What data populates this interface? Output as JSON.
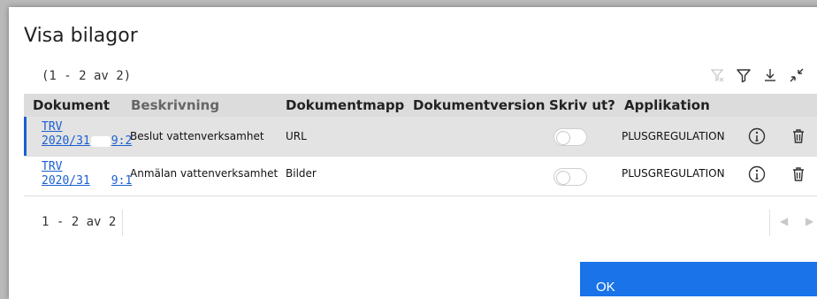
{
  "dialog": {
    "title": "Visa bilagor",
    "count_label": "(1 - 2 av 2)",
    "ok_label": "OK"
  },
  "toolbar": {
    "icons": [
      "clear-filter-icon",
      "filter-icon",
      "download-icon",
      "collapse-icon"
    ]
  },
  "table": {
    "headers": {
      "dokument": "Dokument",
      "beskrivning": "Beskrivning",
      "dokumentmapp": "Dokumentmapp",
      "dokumentversion": "Dokumentversion",
      "skriv_ut": "Skriv ut?",
      "applikation": "Applikation"
    },
    "rows": [
      {
        "doc_line1": "TRV",
        "doc_line2_prefix": "2020/31",
        "doc_line2_suffix": "9:2",
        "beskrivning": "Beslut vattenverksamhet",
        "dokumentmapp": "URL",
        "dokumentversion": "",
        "skriv_ut": false,
        "applikation": "PLUSGREGULATION",
        "selected": true
      },
      {
        "doc_line1": "TRV",
        "doc_line2_prefix": "2020/31",
        "doc_line2_suffix": "9:1",
        "beskrivning": "Anmälan vattenverksamhet",
        "dokumentmapp": "Bilder",
        "dokumentversion": "",
        "skriv_ut": false,
        "applikation": "PLUSGREGULATION",
        "selected": false
      }
    ]
  },
  "pager": {
    "label": "1 - 2 av 2",
    "prev": "◀",
    "next": "▶"
  },
  "colors": {
    "accent": "#1a73e8",
    "link": "#1a5fd0",
    "header_bg": "#dcdcdc",
    "selected_row_bg": "#e3e3e3"
  }
}
